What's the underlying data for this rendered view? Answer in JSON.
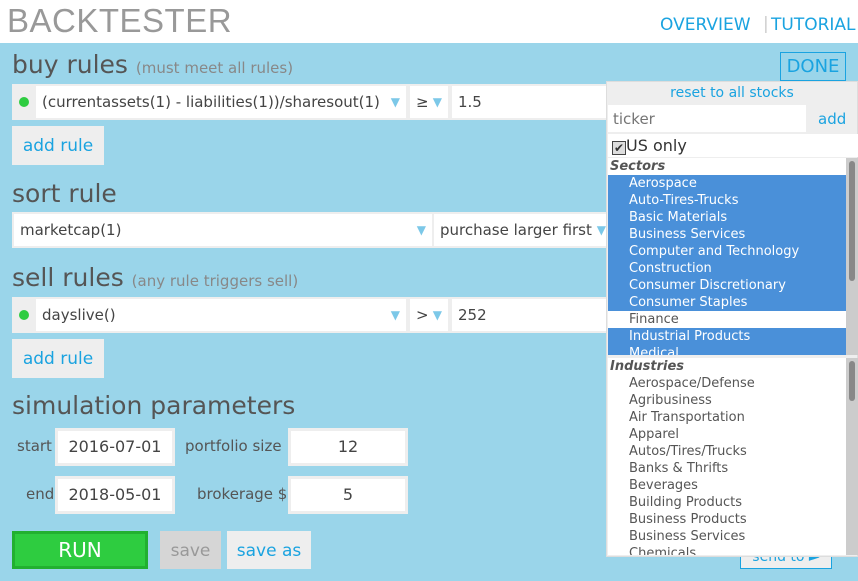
{
  "header": {
    "title": "BACKTESTER",
    "nav": [
      "OVERVIEW",
      "TUTORIAL"
    ]
  },
  "buy": {
    "title": "buy rules",
    "note": "(must meet all rules)",
    "rule": {
      "expr": "(currentassets(1) - liabilities(1))/sharesout(1)",
      "op": "≥",
      "value": "1.5"
    },
    "add": "add rule"
  },
  "sort": {
    "title": "sort rule",
    "field": "marketcap(1)",
    "order": "purchase larger first"
  },
  "sell": {
    "title": "sell rules",
    "note": "(any rule triggers sell)",
    "rule": {
      "expr": "dayslive()",
      "op": ">",
      "value": "252"
    },
    "add": "add rule"
  },
  "sim": {
    "title": "simulation parameters",
    "start_label": "start",
    "start": "2016-07-01",
    "end_label": "end",
    "end": "2018-05-01",
    "size_label": "portfolio size",
    "size": "12",
    "brokerage_label": "brokerage $",
    "brokerage": "5"
  },
  "actions": {
    "run": "RUN",
    "save": "save",
    "save_as": "save as",
    "send_to": "send to ►"
  },
  "panel": {
    "done": "DONE",
    "reset": "reset to all stocks",
    "ticker_placeholder": "ticker",
    "add": "add",
    "us_only": "US only",
    "us_only_checked": true,
    "sectors_label": "Sectors",
    "sectors": [
      {
        "label": "Aerospace",
        "selected": true
      },
      {
        "label": "Auto-Tires-Trucks",
        "selected": true
      },
      {
        "label": "Basic Materials",
        "selected": true
      },
      {
        "label": "Business Services",
        "selected": true
      },
      {
        "label": "Computer and Technology",
        "selected": true
      },
      {
        "label": "Construction",
        "selected": true
      },
      {
        "label": "Consumer Discretionary",
        "selected": true
      },
      {
        "label": "Consumer Staples",
        "selected": true
      },
      {
        "label": "Finance",
        "selected": false
      },
      {
        "label": "Industrial Products",
        "selected": true
      },
      {
        "label": "Medical",
        "selected": true
      }
    ],
    "industries_label": "Industries",
    "industries": [
      "Aerospace/Defense",
      "Agribusiness",
      "Air Transportation",
      "Apparel",
      "Autos/Tires/Trucks",
      "Banks & Thrifts",
      "Beverages",
      "Building Products",
      "Business Products",
      "Business Services",
      "Chemicals"
    ]
  },
  "colors": {
    "background": "#9ad5ea",
    "accent": "#1aa3e0",
    "run": "#2ecc40",
    "selected": "#4a90d9"
  }
}
